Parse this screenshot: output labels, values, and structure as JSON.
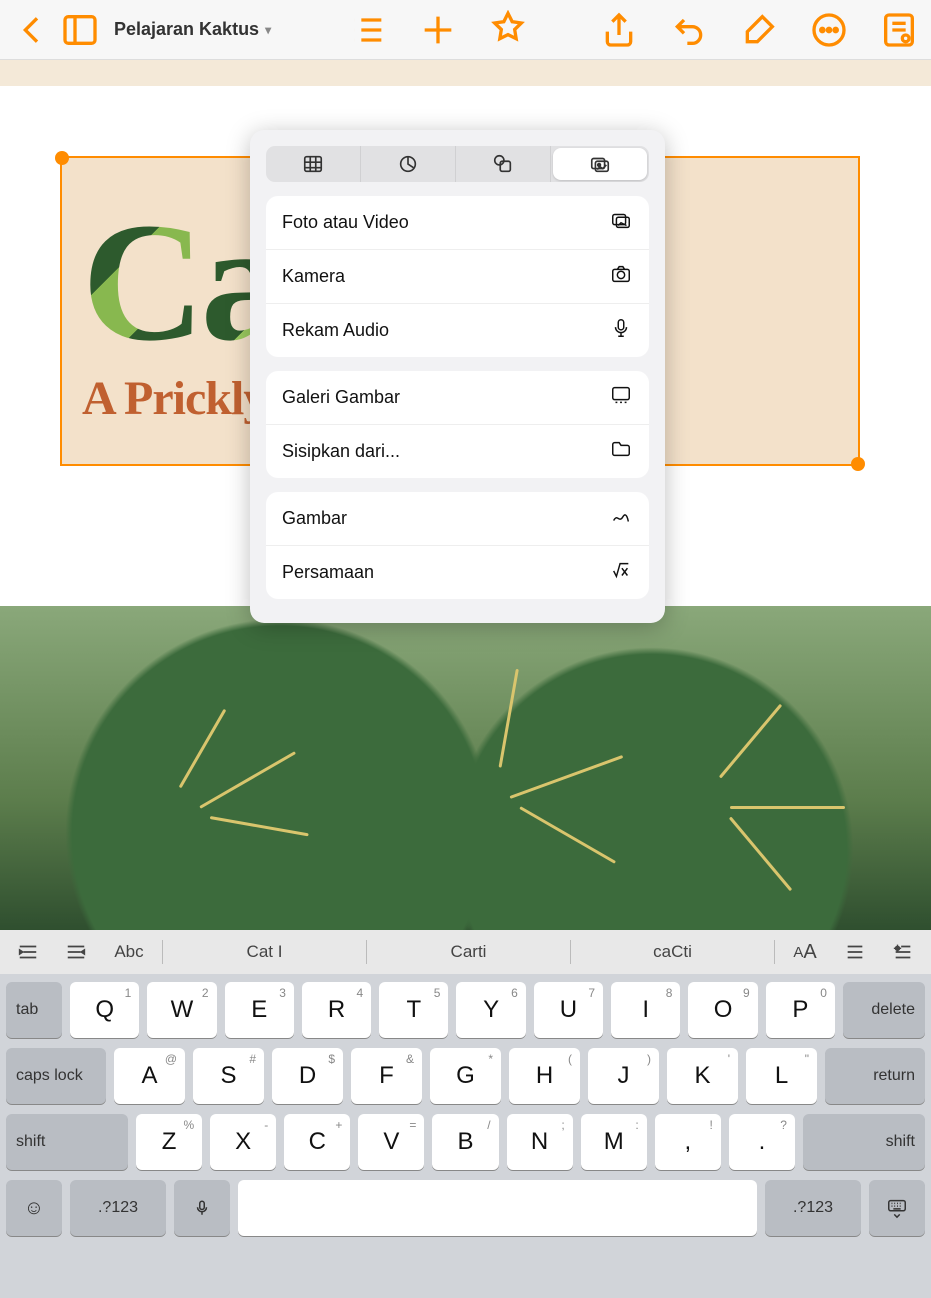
{
  "toolbar": {
    "doc_title": "Pelajaran Kaktus"
  },
  "document": {
    "big_title": "Cacti",
    "subtitle": "A Prickly Introduction"
  },
  "popover": {
    "group1": {
      "photo_video": "Foto atau Video",
      "camera": "Kamera",
      "record_audio": "Rekam Audio"
    },
    "group2": {
      "image_gallery": "Galeri Gambar",
      "insert_from": "Sisipkan dari..."
    },
    "group3": {
      "drawing": "Gambar",
      "equation": "Persamaan"
    }
  },
  "suggestions": {
    "abc": "Abc",
    "s1": "Cat I",
    "s2": "Carti",
    "s3": "caCti"
  },
  "keyboard": {
    "row1_subs": [
      "1",
      "2",
      "3",
      "4",
      "5",
      "6",
      "7",
      "8",
      "9",
      "0"
    ],
    "row1": [
      "Q",
      "W",
      "E",
      "R",
      "T",
      "Y",
      "U",
      "I",
      "O",
      "P"
    ],
    "row2_subs": [
      "@",
      "#",
      "$",
      "&",
      "*",
      "(",
      ")",
      "'",
      "\""
    ],
    "row2": [
      "A",
      "S",
      "D",
      "F",
      "G",
      "H",
      "J",
      "K",
      "L"
    ],
    "row3_subs": [
      "%",
      "-",
      "+",
      "=",
      "/",
      ";",
      ":",
      "!",
      "?"
    ],
    "row3": [
      "Z",
      "X",
      "C",
      "V",
      "B",
      "N",
      "M",
      ",",
      "."
    ],
    "tab": "tab",
    "delete": "delete",
    "caps": "caps lock",
    "return": "return",
    "shift": "shift",
    "numkey": ".?123"
  }
}
